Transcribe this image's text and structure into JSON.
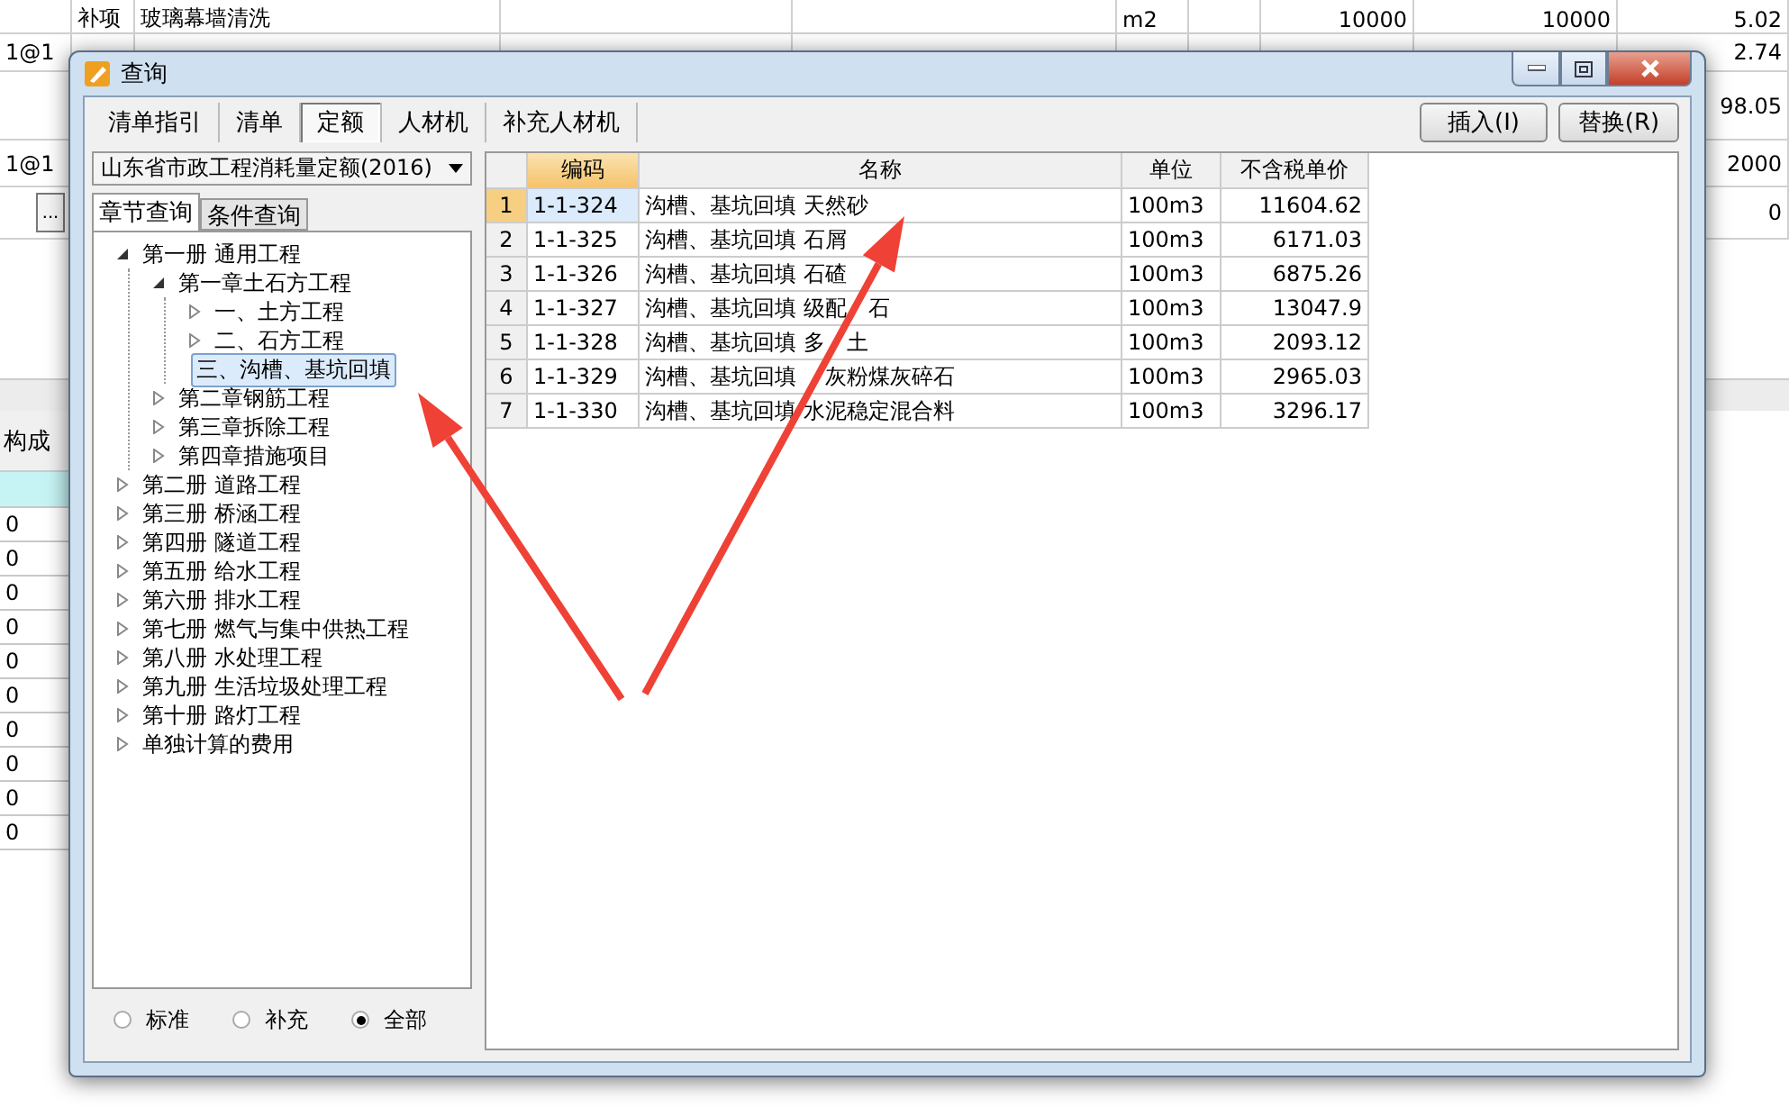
{
  "background": {
    "top_rows": [
      {
        "column_1": "补项",
        "column_2": "玻璃幕墙清洗",
        "column_5": "m2",
        "column_7": "10000",
        "column_8": "10000",
        "column_9": "5.02"
      },
      {
        "column_0": "1@1",
        "column_9": "2.74"
      },
      {
        "column_9": "98.05"
      },
      {
        "column_0": "1@1",
        "column_9": "2000"
      },
      {
        "button": "...",
        "column_9": "0"
      }
    ],
    "lower_panel": {
      "header": "构成",
      "rows": [
        {
          "selected": true
        },
        {
          "value": "0",
          "selected": false
        },
        {
          "value": "0",
          "selected": false
        },
        {
          "value": "0",
          "selected": false
        },
        {
          "value": "0",
          "selected": false
        },
        {
          "value": "0",
          "selected": false
        },
        {
          "value": "0",
          "selected": false
        },
        {
          "value": "0",
          "selected": false
        },
        {
          "value": "0",
          "selected": false
        },
        {
          "value": "0",
          "selected": false
        },
        {
          "value": "0",
          "selected": false
        }
      ]
    }
  },
  "dialog": {
    "title": "查询",
    "tabs": [
      {
        "label": "清单指引",
        "selected": false
      },
      {
        "label": "清单",
        "selected": false
      },
      {
        "label": "定额",
        "selected": true
      },
      {
        "label": "人材机",
        "selected": false
      },
      {
        "label": "补充人材机",
        "selected": false
      }
    ],
    "buttons": [
      "插入(I)",
      "替换(R)"
    ],
    "library": "山东省市政工程消耗量定额(2016)",
    "subtabs": [
      {
        "label": "章节查询",
        "selected": true
      },
      {
        "label": "条件查询",
        "selected": false
      }
    ],
    "tree": [
      {
        "label": "第一册 通用工程",
        "kind": "open",
        "selected": false,
        "children": [
          {
            "label": "第一章土石方工程",
            "kind": "open",
            "selected": false,
            "children": [
              {
                "label": "一、土方工程",
                "kind": "closed",
                "selected": false
              },
              {
                "label": "二、石方工程",
                "kind": "closed",
                "selected": false
              },
              {
                "label": "三、沟槽、基坑回填",
                "kind": "leaf",
                "selected": true
              }
            ]
          },
          {
            "label": "第二章钢筋工程",
            "kind": "closed",
            "selected": false
          },
          {
            "label": "第三章拆除工程",
            "kind": "closed",
            "selected": false
          },
          {
            "label": "第四章措施项目",
            "kind": "closed",
            "selected": false
          }
        ]
      },
      {
        "label": "第二册 道路工程",
        "kind": "closed",
        "selected": false
      },
      {
        "label": "第三册 桥涵工程",
        "kind": "closed",
        "selected": false
      },
      {
        "label": "第四册 隧道工程",
        "kind": "closed",
        "selected": false
      },
      {
        "label": "第五册 给水工程",
        "kind": "closed",
        "selected": false
      },
      {
        "label": "第六册 排水工程",
        "kind": "closed",
        "selected": false
      },
      {
        "label": "第七册 燃气与集中供热工程",
        "kind": "closed",
        "selected": false
      },
      {
        "label": "第八册 水处理工程",
        "kind": "closed",
        "selected": false
      },
      {
        "label": "第九册 生活垃圾处理工程",
        "kind": "closed",
        "selected": false
      },
      {
        "label": "第十册 路灯工程",
        "kind": "closed",
        "selected": false
      },
      {
        "label": "单独计算的费用",
        "kind": "closed",
        "selected": false
      }
    ],
    "filters": [
      {
        "label": "标准",
        "selected": false
      },
      {
        "label": "补充",
        "selected": false
      },
      {
        "label": "全部",
        "selected": true
      }
    ],
    "table": {
      "columns": [
        "编码",
        "名称",
        "单位",
        "不含税单价"
      ],
      "rows": [
        {
          "index": "1",
          "code": "1-1-324",
          "name": "沟槽、基坑回填 天然砂",
          "unit": "100m3",
          "price": "11604.62",
          "selected": true
        },
        {
          "index": "2",
          "code": "1-1-325",
          "name": "沟槽、基坑回填 石屑",
          "unit": "100m3",
          "price": "6171.03",
          "selected": false
        },
        {
          "index": "3",
          "code": "1-1-326",
          "name": "沟槽、基坑回填 石碴",
          "unit": "100m3",
          "price": "6875.26",
          "selected": false
        },
        {
          "index": "4",
          "code": "1-1-327",
          "name": "沟槽、基坑回填 级配　石",
          "unit": "100m3",
          "price": "13047.9",
          "selected": false
        },
        {
          "index": "5",
          "code": "1-1-328",
          "name": "沟槽、基坑回填 多　土",
          "unit": "100m3",
          "price": "2093.12",
          "selected": false
        },
        {
          "index": "6",
          "code": "1-1-329",
          "name": "沟槽、基坑回填 　灰粉煤灰碎石",
          "unit": "100m3",
          "price": "2965.03",
          "selected": false
        },
        {
          "index": "7",
          "code": "1-1-330",
          "name": "沟槽、基坑回填 水泥稳定混合料",
          "unit": "100m3",
          "price": "3296.17",
          "selected": false
        }
      ]
    }
  }
}
